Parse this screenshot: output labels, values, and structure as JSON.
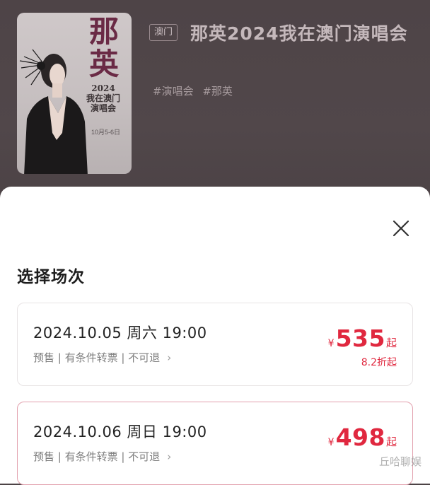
{
  "poster": {
    "title": "那英",
    "subtitle_line1": "2024",
    "subtitle_line2": "我在澳门",
    "subtitle_line3": "演唱会",
    "date": "10月5-6日"
  },
  "event": {
    "venue_tag": "澳门",
    "title": "那英2024我在澳门演唱会",
    "tags": [
      "#演唱会",
      "#那英"
    ]
  },
  "sheet": {
    "title": "选择场次",
    "sessions": [
      {
        "datetime": "2024.10.05 周六 19:00",
        "desc": "预售 | 有条件转票 | 不可退",
        "currency": "¥",
        "price": "535",
        "price_suffix": "起",
        "discount": "8.2折起",
        "selected": false
      },
      {
        "datetime": "2024.10.06 周日 19:00",
        "desc": "预售 | 有条件转票 | 不可退",
        "currency": "¥",
        "price": "498",
        "price_suffix": "起",
        "discount": "",
        "selected": true
      }
    ]
  },
  "icons": {
    "close": "close-icon",
    "chevron": "chevron-right-icon"
  },
  "colors": {
    "price": "#e0283f",
    "selected_border": "#e2a0ad",
    "overlay": "#4d4346"
  },
  "watermark": "丘哈聊娱"
}
